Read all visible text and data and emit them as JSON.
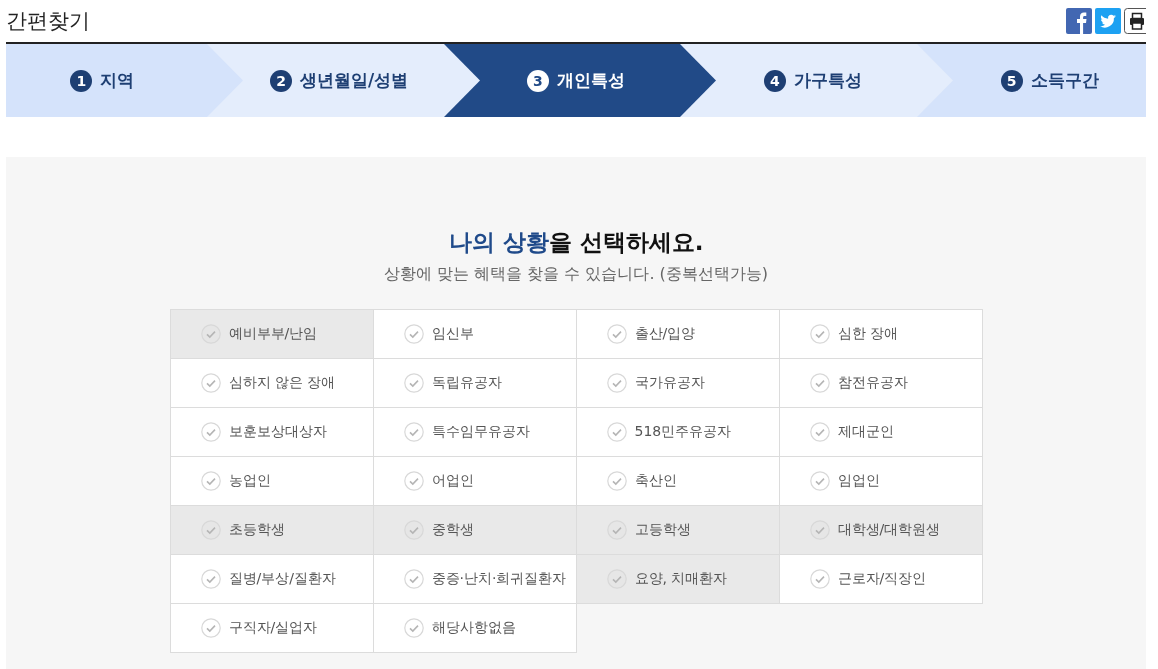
{
  "header": {
    "title": "간편찾기"
  },
  "steps": [
    {
      "number": "1",
      "label": "지역",
      "selected": false
    },
    {
      "number": "2",
      "label": "생년월일/성별",
      "selected": false
    },
    {
      "number": "3",
      "label": "개인특성",
      "selected": true
    },
    {
      "number": "4",
      "label": "가구특성",
      "selected": false
    },
    {
      "number": "5",
      "label": "소득구간",
      "selected": false
    }
  ],
  "heading": {
    "highlight": "나의 상황",
    "rest": "을 선택하세요."
  },
  "subheading": "상황에 맞는 혜택을 찾을 수 있습니다. (중복선택가능)",
  "options": [
    {
      "label": "예비부부/난임",
      "disabled": true
    },
    {
      "label": "임신부",
      "disabled": false
    },
    {
      "label": "출산/입양",
      "disabled": false
    },
    {
      "label": "심한 장애",
      "disabled": false
    },
    {
      "label": "심하지 않은 장애",
      "disabled": false
    },
    {
      "label": "독립유공자",
      "disabled": false
    },
    {
      "label": "국가유공자",
      "disabled": false
    },
    {
      "label": "참전유공자",
      "disabled": false
    },
    {
      "label": "보훈보상대상자",
      "disabled": false
    },
    {
      "label": "특수임무유공자",
      "disabled": false
    },
    {
      "label": "518민주유공자",
      "disabled": false
    },
    {
      "label": "제대군인",
      "disabled": false
    },
    {
      "label": "농업인",
      "disabled": false
    },
    {
      "label": "어업인",
      "disabled": false
    },
    {
      "label": "축산인",
      "disabled": false
    },
    {
      "label": "임업인",
      "disabled": false
    },
    {
      "label": "초등학생",
      "disabled": true
    },
    {
      "label": "중학생",
      "disabled": true
    },
    {
      "label": "고등학생",
      "disabled": true
    },
    {
      "label": "대학생/대학원생",
      "disabled": true
    },
    {
      "label": "질병/부상/질환자",
      "disabled": false
    },
    {
      "label": "중증·난치·희귀질환자",
      "disabled": false
    },
    {
      "label": "요양, 치매환자",
      "disabled": true
    },
    {
      "label": "근로자/직장인",
      "disabled": false
    },
    {
      "label": "구직자/실업자",
      "disabled": false
    },
    {
      "label": "해당사항없음",
      "disabled": false
    }
  ]
}
